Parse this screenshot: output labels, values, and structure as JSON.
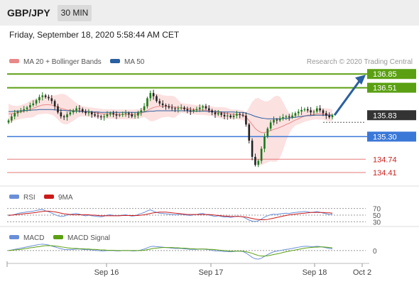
{
  "header": {
    "symbol": "GBP/JPY",
    "timeframe": "30 MIN",
    "datetime": "Friday, September 18, 2020 5:58:44 AM CET"
  },
  "legend": {
    "ma20": "MA 20 + Bollinger Bands",
    "ma50": "MA 50",
    "copyright": "Research © 2020 Trading Central",
    "rsi": "RSI",
    "rsi_ma": "9MA",
    "macd": "MACD",
    "macd_signal": "MACD Signal"
  },
  "colors": {
    "resistance": "#5aa012",
    "support": "#3a78d8",
    "minor_support": "#e67878",
    "current": "#333333",
    "arrow": "#2a5fa0",
    "up_candle": "#1a7a1a",
    "down_candle": "#222222",
    "ma20": "#e88888",
    "ma50": "#2a5fa0",
    "band_fill": "#fbd9d9",
    "rsi": "#6a8fd8",
    "rsi_ma": "#cc1a1a",
    "macd": "#6a8fd8",
    "macd_signal": "#5aa012"
  },
  "chart_data": [
    {
      "type": "candlestick",
      "ylim": [
        134.2,
        137.1
      ],
      "x_ticks": [
        "Sep 16",
        "Sep 17",
        "Sep 18",
        "Oct 2"
      ],
      "levels": [
        {
          "value": 136.85,
          "label": "136.85",
          "kind": "resistance"
        },
        {
          "value": 136.51,
          "label": "136.51",
          "kind": "resistance"
        },
        {
          "value": 135.83,
          "label": "135.83",
          "kind": "current"
        },
        {
          "value": 135.3,
          "label": "135.30",
          "kind": "support"
        },
        {
          "value": 134.74,
          "label": "134.74",
          "kind": "minor_support"
        },
        {
          "value": 134.41,
          "label": "134.41",
          "kind": "minor_support"
        }
      ],
      "forecast_arrow": {
        "from": 135.83,
        "to": 136.85
      },
      "closes": [
        135.7,
        135.8,
        135.88,
        135.92,
        135.95,
        135.98,
        136.02,
        136.08,
        136.12,
        136.2,
        136.28,
        136.32,
        136.28,
        136.25,
        136.18,
        136.05,
        135.9,
        135.8,
        135.78,
        135.85,
        135.9,
        135.95,
        136.0,
        135.98,
        135.92,
        135.88,
        135.9,
        135.85,
        135.82,
        135.8,
        135.78,
        135.8,
        135.85,
        135.88,
        135.85,
        135.82,
        135.84,
        135.86,
        135.88,
        135.85,
        135.8,
        135.82,
        135.9,
        135.95,
        136.05,
        136.25,
        136.38,
        136.3,
        136.18,
        136.12,
        136.08,
        136.05,
        136.02,
        136.0,
        135.98,
        136.0,
        136.02,
        135.98,
        135.95,
        135.92,
        135.96,
        135.98,
        136.02,
        136.05,
        136.0,
        135.95,
        135.9,
        135.85,
        135.88,
        135.84,
        135.8,
        135.82,
        135.78,
        135.82,
        135.86,
        135.84,
        135.82,
        135.6,
        135.2,
        134.8,
        134.6,
        134.7,
        135.0,
        135.3,
        135.5,
        135.65,
        135.72,
        135.7,
        135.75,
        135.78,
        135.8,
        135.78,
        135.82,
        135.88,
        135.92,
        135.96,
        135.98,
        135.95,
        135.9,
        135.92,
        136.0,
        135.95,
        135.88,
        135.82,
        135.78,
        135.83
      ],
      "ma20": [
        135.86,
        135.87,
        135.88,
        135.89,
        135.91,
        135.93,
        135.95,
        135.98,
        136.0,
        136.03,
        136.06,
        136.08,
        136.09,
        136.09,
        136.08,
        136.06,
        136.03,
        136.0,
        135.98,
        135.96,
        135.95,
        135.94,
        135.94,
        135.94,
        135.93,
        135.92,
        135.91,
        135.9,
        135.89,
        135.88,
        135.87,
        135.86,
        135.86,
        135.86,
        135.86,
        135.85,
        135.85,
        135.85,
        135.85,
        135.85,
        135.85,
        135.85,
        135.86,
        135.88,
        135.91,
        135.95,
        135.99,
        136.02,
        136.04,
        136.05,
        136.05,
        136.05,
        136.05,
        136.04,
        136.03,
        136.02,
        136.01,
        136.0,
        135.99,
        135.98,
        135.97,
        135.96,
        135.96,
        135.96,
        135.95,
        135.94,
        135.93,
        135.91,
        135.9,
        135.89,
        135.88,
        135.87,
        135.86,
        135.85,
        135.85,
        135.84,
        135.83,
        135.78,
        135.7,
        135.6,
        135.5,
        135.44,
        135.4,
        135.4,
        135.42,
        135.45,
        135.48,
        135.5,
        135.53,
        135.56,
        135.6,
        135.63,
        135.67,
        135.71,
        135.74,
        135.78,
        135.81,
        135.83,
        135.84,
        135.85,
        135.86,
        135.86,
        135.86,
        135.85,
        135.84,
        135.83
      ],
      "ma50": [
        135.92,
        135.92,
        135.93,
        135.93,
        135.94,
        135.94,
        135.95,
        135.95,
        135.96,
        135.96,
        135.97,
        135.97,
        135.97,
        135.97,
        135.97,
        135.96,
        135.96,
        135.95,
        135.95,
        135.94,
        135.94,
        135.93,
        135.93,
        135.93,
        135.92,
        135.92,
        135.92,
        135.91,
        135.91,
        135.91,
        135.9,
        135.9,
        135.9,
        135.9,
        135.9,
        135.9,
        135.9,
        135.9,
        135.9,
        135.9,
        135.9,
        135.9,
        135.9,
        135.91,
        135.91,
        135.92,
        135.93,
        135.93,
        135.94,
        135.94,
        135.94,
        135.94,
        135.94,
        135.94,
        135.94,
        135.94,
        135.94,
        135.94,
        135.94,
        135.93,
        135.93,
        135.93,
        135.93,
        135.93,
        135.93,
        135.92,
        135.92,
        135.92,
        135.92,
        135.91,
        135.91,
        135.91,
        135.91,
        135.91,
        135.9,
        135.9,
        135.9,
        135.88,
        135.86,
        135.83,
        135.8,
        135.78,
        135.76,
        135.75,
        135.74,
        135.74,
        135.74,
        135.74,
        135.74,
        135.75,
        135.75,
        135.76,
        135.77,
        135.78,
        135.79,
        135.8,
        135.81,
        135.82,
        135.82,
        135.83,
        135.83,
        135.83,
        135.83,
        135.83,
        135.83,
        135.83
      ]
    },
    {
      "type": "line",
      "name": "RSI",
      "ylim": [
        20,
        80
      ],
      "levels": [
        70,
        50,
        30
      ],
      "rsi": [
        48,
        50,
        52,
        55,
        57,
        58,
        60,
        61,
        62,
        64,
        66,
        67,
        63,
        60,
        56,
        52,
        48,
        46,
        47,
        50,
        52,
        54,
        55,
        53,
        50,
        48,
        50,
        48,
        47,
        46,
        45,
        47,
        50,
        51,
        49,
        48,
        49,
        50,
        51,
        49,
        47,
        48,
        52,
        55,
        58,
        63,
        66,
        62,
        58,
        56,
        55,
        54,
        53,
        52,
        51,
        52,
        53,
        51,
        50,
        49,
        51,
        52,
        54,
        55,
        52,
        50,
        48,
        46,
        48,
        46,
        44,
        45,
        43,
        45,
        47,
        46,
        45,
        40,
        35,
        32,
        31,
        33,
        38,
        44,
        48,
        51,
        53,
        52,
        54,
        55,
        56,
        55,
        57,
        58,
        59,
        60,
        61,
        60,
        58,
        59,
        61,
        59,
        56,
        54,
        52,
        53
      ],
      "ma": [
        50,
        50,
        51,
        52,
        53,
        54,
        55,
        56,
        57,
        58,
        60,
        61,
        62,
        62,
        61,
        60,
        58,
        56,
        54,
        53,
        52,
        51,
        51,
        51,
        51,
        51,
        51,
        50,
        50,
        49,
        48,
        48,
        48,
        48,
        48,
        48,
        48,
        49,
        49,
        49,
        49,
        49,
        49,
        50,
        51,
        53,
        55,
        57,
        58,
        59,
        59,
        59,
        58,
        57,
        56,
        55,
        54,
        53,
        52,
        52,
        52,
        52,
        52,
        52,
        52,
        52,
        51,
        50,
        49,
        48,
        47,
        47,
        46,
        46,
        46,
        46,
        45,
        44,
        42,
        40,
        38,
        37,
        36,
        36,
        37,
        39,
        41,
        43,
        45,
        47,
        49,
        51,
        52,
        53,
        54,
        55,
        56,
        57,
        58,
        58,
        58,
        58,
        58,
        57,
        57,
        56
      ],
      "labels": [
        "70",
        "50",
        "30"
      ]
    },
    {
      "type": "line",
      "name": "MACD",
      "ylim": [
        -0.35,
        0.3
      ],
      "zero_label": "0",
      "macd": [
        0.0,
        0.02,
        0.04,
        0.06,
        0.08,
        0.1,
        0.12,
        0.14,
        0.16,
        0.18,
        0.2,
        0.21,
        0.2,
        0.18,
        0.15,
        0.12,
        0.09,
        0.06,
        0.04,
        0.03,
        0.03,
        0.04,
        0.05,
        0.05,
        0.04,
        0.03,
        0.03,
        0.02,
        0.01,
        0.0,
        -0.01,
        -0.01,
        0.0,
        0.0,
        0.0,
        -0.01,
        -0.01,
        0.0,
        0.0,
        0.0,
        -0.01,
        -0.01,
        0.0,
        0.02,
        0.05,
        0.09,
        0.13,
        0.14,
        0.13,
        0.12,
        0.11,
        0.1,
        0.09,
        0.08,
        0.07,
        0.07,
        0.07,
        0.06,
        0.05,
        0.04,
        0.04,
        0.04,
        0.05,
        0.05,
        0.04,
        0.03,
        0.01,
        -0.01,
        -0.01,
        -0.02,
        -0.03,
        -0.03,
        -0.04,
        -0.03,
        -0.02,
        -0.02,
        -0.03,
        -0.08,
        -0.15,
        -0.22,
        -0.27,
        -0.28,
        -0.25,
        -0.19,
        -0.13,
        -0.08,
        -0.04,
        -0.02,
        0.0,
        0.02,
        0.04,
        0.05,
        0.07,
        0.09,
        0.11,
        0.13,
        0.14,
        0.14,
        0.13,
        0.13,
        0.14,
        0.13,
        0.11,
        0.09,
        0.07,
        0.06
      ],
      "signal": [
        0.0,
        0.01,
        0.02,
        0.03,
        0.04,
        0.06,
        0.07,
        0.09,
        0.1,
        0.12,
        0.13,
        0.15,
        0.16,
        0.16,
        0.16,
        0.15,
        0.14,
        0.12,
        0.11,
        0.09,
        0.08,
        0.07,
        0.07,
        0.06,
        0.06,
        0.05,
        0.05,
        0.04,
        0.04,
        0.03,
        0.02,
        0.02,
        0.01,
        0.01,
        0.01,
        0.0,
        0.0,
        0.0,
        0.0,
        0.0,
        0.0,
        0.0,
        0.0,
        0.0,
        0.01,
        0.03,
        0.05,
        0.07,
        0.08,
        0.09,
        0.1,
        0.1,
        0.1,
        0.1,
        0.09,
        0.09,
        0.08,
        0.08,
        0.07,
        0.06,
        0.06,
        0.05,
        0.05,
        0.05,
        0.05,
        0.04,
        0.04,
        0.03,
        0.02,
        0.01,
        0.0,
        -0.01,
        -0.02,
        -0.02,
        -0.02,
        -0.02,
        -0.02,
        -0.04,
        -0.06,
        -0.09,
        -0.13,
        -0.16,
        -0.18,
        -0.18,
        -0.17,
        -0.15,
        -0.13,
        -0.11,
        -0.09,
        -0.06,
        -0.04,
        -0.02,
        0.0,
        0.02,
        0.04,
        0.06,
        0.08,
        0.09,
        0.1,
        0.11,
        0.11,
        0.12,
        0.12,
        0.11,
        0.1,
        0.09
      ]
    }
  ]
}
